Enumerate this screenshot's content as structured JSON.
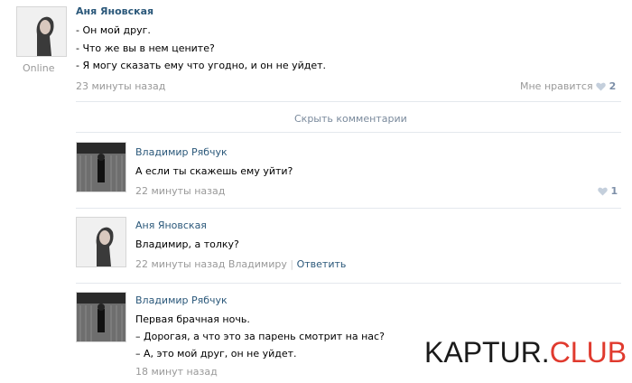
{
  "post": {
    "author": "Аня Яновская",
    "status": "Online",
    "lines": [
      "- Он мой друг.",
      "- Что же вы в нем цените?",
      "- Я могу сказать ему что угодно, и он не уйдет."
    ],
    "time": "23 минуты назад",
    "like_label": "Мне нравится",
    "like_count": "2"
  },
  "hide_comments_label": "Скрыть комментарии",
  "comments": [
    {
      "author": "Владимир Рябчук",
      "lines": [
        "А если ты скажешь ему уйти?"
      ],
      "time": "22 минуты назад",
      "like_count": "1"
    },
    {
      "author": "Аня Яновская",
      "lines": [
        "Владимир, а толку?"
      ],
      "time": "22 минуты назад Владимиру",
      "divider": "|",
      "reply_label": "Ответить"
    },
    {
      "author": "Владимир Рябчук",
      "lines": [
        "Первая брачная ночь.",
        "– Дорогая, а что это за парень смотрит на нас?",
        "– А, это мой друг, он не уйдет."
      ],
      "time": "18 минут назад"
    }
  ],
  "watermark": {
    "part1": "KAPTUR.",
    "part2": "CLUB"
  },
  "colors": {
    "link": "#2b587a",
    "meta": "#999999",
    "heart": "#c4cfdc",
    "watermark_accent": "#e03a2e"
  }
}
